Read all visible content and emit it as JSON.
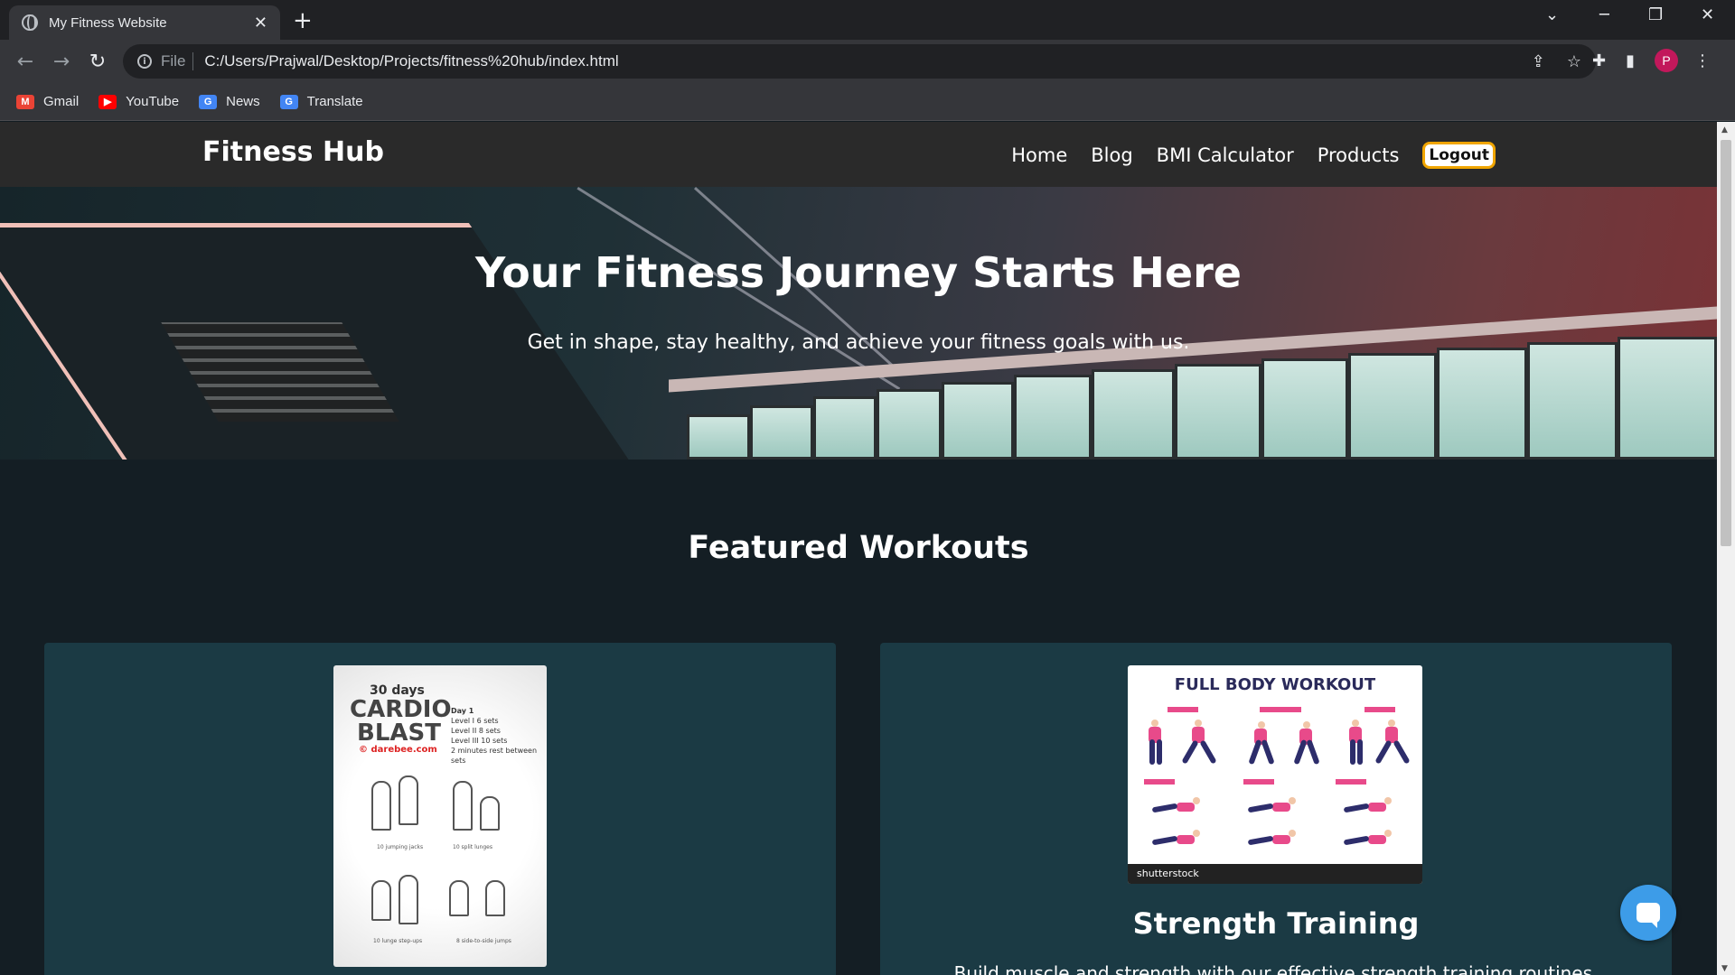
{
  "browser": {
    "tab_title": "My Fitness Website",
    "tab_close": "✕",
    "new_tab": "+",
    "scheme": "File",
    "url": "C:/Users/Prajwal/Desktop/Projects/fitness%20hub/index.html",
    "profile_initial": "P",
    "bookmarks": [
      {
        "label": "Gmail",
        "icon": "gmail-icon",
        "color": "#ea4335"
      },
      {
        "label": "YouTube",
        "icon": "youtube-icon",
        "color": "#ff0000"
      },
      {
        "label": "News",
        "icon": "news-icon",
        "color": "#4285f4"
      },
      {
        "label": "Translate",
        "icon": "translate-icon",
        "color": "#4285f4"
      }
    ]
  },
  "site": {
    "brand": "Fitness Hub",
    "nav": [
      "Home",
      "Blog",
      "BMI Calculator",
      "Products"
    ],
    "logout": "Logout",
    "hero": {
      "title": "Your Fitness Journey Starts Here",
      "subtitle": "Get in shape, stay healthy, and achieve your fitness goals with us."
    },
    "featured_title": "Featured Workouts",
    "cards": [
      {
        "title": "",
        "text": "",
        "poster": {
          "days": "30 days",
          "line1": "CARDIO",
          "line2": "BLAST",
          "site": "© darebee.com",
          "side": [
            "Day 1",
            "Level I  6 sets",
            "Level II  8 sets",
            "Level III  10 sets",
            "2 minutes rest between sets"
          ],
          "captions": [
            "10 jumping jacks",
            "10 split lunges",
            "10 lunge step-ups",
            "8 side-to-side jumps"
          ]
        }
      },
      {
        "title": "Strength Training",
        "text": "Build muscle and strength with our effective strength training routines.",
        "poster": {
          "title": "FULL BODY WORKOUT",
          "footer": "shutterstock"
        }
      }
    ]
  },
  "colors": {
    "accent_logout_border": "#f0a500",
    "card_bg": "#1b3a44",
    "page_bg": "#141e24",
    "chat_button": "#3d9ce8"
  }
}
